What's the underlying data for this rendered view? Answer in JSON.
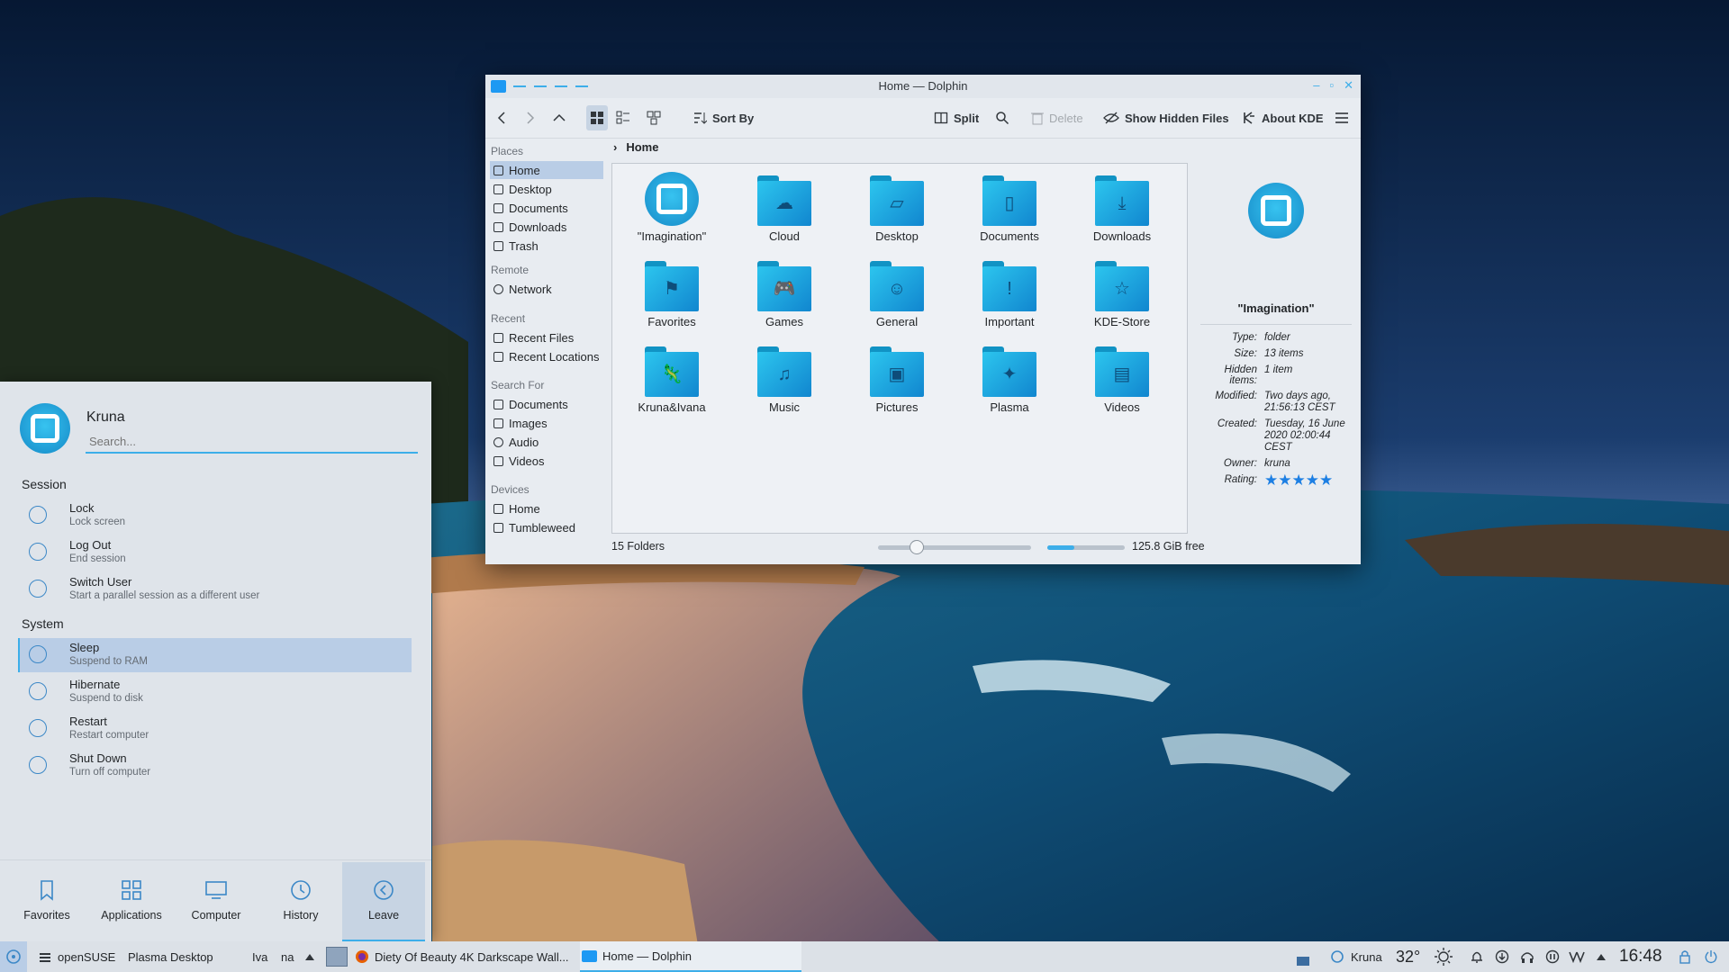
{
  "window": {
    "title": "Home — Dolphin",
    "controls": [
      "–",
      "▫",
      "✕"
    ]
  },
  "toolbar": {
    "sort_by": "Sort By",
    "split": "Split",
    "delete": "Delete",
    "show_hidden": "Show Hidden Files",
    "about_kde": "About KDE"
  },
  "sidebar": {
    "places_header": "Places",
    "places": [
      {
        "label": "Home",
        "icon": "home-icon"
      },
      {
        "label": "Desktop",
        "icon": "desktop-icon"
      },
      {
        "label": "Documents",
        "icon": "documents-icon"
      },
      {
        "label": "Downloads",
        "icon": "downloads-icon"
      },
      {
        "label": "Trash",
        "icon": "trash-icon"
      }
    ],
    "remote_header": "Remote",
    "remote": [
      {
        "label": "Network",
        "icon": "network-icon"
      }
    ],
    "recent_header": "Recent",
    "recent": [
      {
        "label": "Recent Files",
        "icon": "recent-files-icon"
      },
      {
        "label": "Recent Locations",
        "icon": "recent-locations-icon"
      }
    ],
    "search_header": "Search For",
    "search": [
      {
        "label": "Documents",
        "icon": "documents-icon"
      },
      {
        "label": "Images",
        "icon": "images-icon"
      },
      {
        "label": "Audio",
        "icon": "audio-icon"
      },
      {
        "label": "Videos",
        "icon": "videos-icon"
      }
    ],
    "devices_header": "Devices",
    "devices": [
      {
        "label": "Home",
        "icon": "drive-icon"
      },
      {
        "label": "Tumbleweed",
        "icon": "drive-icon"
      }
    ]
  },
  "breadcrumb": {
    "separator": "›",
    "current": "Home"
  },
  "files": [
    {
      "name": "\"Imagination\"",
      "icon": "logo"
    },
    {
      "name": "Cloud",
      "icon": "☁"
    },
    {
      "name": "Desktop",
      "icon": "▱"
    },
    {
      "name": "Documents",
      "icon": "▯"
    },
    {
      "name": "Downloads",
      "icon": "⤓"
    },
    {
      "name": "Favorites",
      "icon": "⚑"
    },
    {
      "name": "Games",
      "icon": "🎮"
    },
    {
      "name": "General",
      "icon": "☺"
    },
    {
      "name": "Important",
      "icon": "!"
    },
    {
      "name": "KDE-Store",
      "icon": "☆"
    },
    {
      "name": "Kruna&Ivana",
      "icon": "🦎"
    },
    {
      "name": "Music",
      "icon": "♫"
    },
    {
      "name": "Pictures",
      "icon": "▣"
    },
    {
      "name": "Plasma",
      "icon": "✦"
    },
    {
      "name": "Videos",
      "icon": "▤"
    }
  ],
  "status": {
    "count": "15 Folders",
    "zoom_fraction": 0.25,
    "space_used_fraction": 0.35,
    "free": "125.8 GiB free"
  },
  "info_panel": {
    "title": "\"Imagination\"",
    "rows": [
      {
        "k": "Type:",
        "v": "folder"
      },
      {
        "k": "Size:",
        "v": "13 items"
      },
      {
        "k": "Hidden items:",
        "v": "1 item"
      },
      {
        "k": "Modified:",
        "v": "Two days ago, 21:56:13 CEST"
      },
      {
        "k": "Created:",
        "v": "Tuesday, 16 June 2020 02:00:44 CEST"
      },
      {
        "k": "Owner:",
        "v": "kruna"
      }
    ],
    "rating_label": "Rating:",
    "rating": 5
  },
  "kickoff": {
    "user": "Kruna",
    "search_placeholder": "Search...",
    "session_header": "Session",
    "session": [
      {
        "title": "Lock",
        "sub": "Lock screen"
      },
      {
        "title": "Log Out",
        "sub": "End session"
      },
      {
        "title": "Switch User",
        "sub": "Start a parallel session as a different user"
      }
    ],
    "system_header": "System",
    "system": [
      {
        "title": "Sleep",
        "sub": "Suspend to RAM"
      },
      {
        "title": "Hibernate",
        "sub": "Suspend to disk"
      },
      {
        "title": "Restart",
        "sub": "Restart computer"
      },
      {
        "title": "Shut Down",
        "sub": "Turn off computer"
      }
    ],
    "tabs": [
      "Favorites",
      "Applications",
      "Computer",
      "History",
      "Leave"
    ]
  },
  "taskbar": {
    "items": [
      "openSUSE",
      "Plasma Desktop",
      "Iva",
      "na"
    ],
    "tasks": [
      "Diety Of Beauty 4K Darkscape Wall...",
      "Home — Dolphin"
    ],
    "user": "Kruna",
    "temperature": "32°",
    "clock": "16:48"
  },
  "colors": {
    "accent": "#3daee9",
    "selection": "#b9cde6",
    "folder": "#1d99f3",
    "rating_star": "#1d7fe3"
  }
}
